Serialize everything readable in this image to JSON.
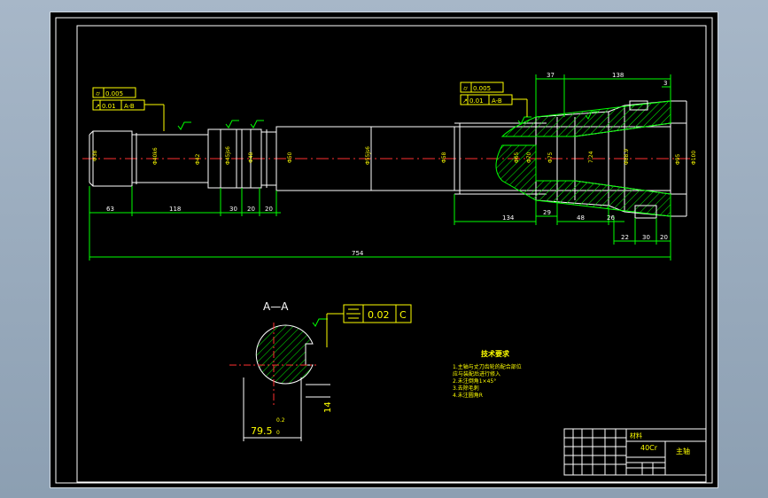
{
  "colors": {
    "background": "#000000",
    "frame": "#ffffff",
    "dimension": "#00ff00",
    "annotation": "#ffff00",
    "center": "#ff0000",
    "part": "#ffffff"
  },
  "tolerance_left": {
    "row1_value": "0.005",
    "row2_value": "0.01",
    "row2_datum": "A-B"
  },
  "tolerance_right": {
    "row1_value": "0.005",
    "row2_value": "0.01",
    "row2_datum": "A-B"
  },
  "dims_bottom": {
    "d1": "63",
    "d2": "118",
    "d3": "30",
    "d4": "20",
    "d5": "20",
    "d6": "134",
    "d7": "29",
    "d8": "48",
    "d9": "26",
    "d10": "22",
    "d11": "30",
    "d12": "20",
    "overall": "754"
  },
  "dims_top": {
    "t1": "37",
    "t2": "138",
    "t3": "3"
  },
  "section": {
    "title": "A—A",
    "tolerance_value": "0.02",
    "tolerance_datum": "C",
    "width_dim": "14",
    "dia_dim": "79.5",
    "dia_tol_upper": "0.2",
    "dia_tol_lower": "0"
  },
  "tech_requirements": {
    "title": "技术要求",
    "items": [
      "1.主轴与丈刀齿轮的配合部位",
      "  应与装配后进行修入",
      "2.未注倒角1×45°",
      "3.去除毛刺",
      "4.未注圆角R"
    ]
  },
  "title_block": {
    "material_label": "材料",
    "material_value": "40Cr",
    "part_name": "主轴"
  }
}
